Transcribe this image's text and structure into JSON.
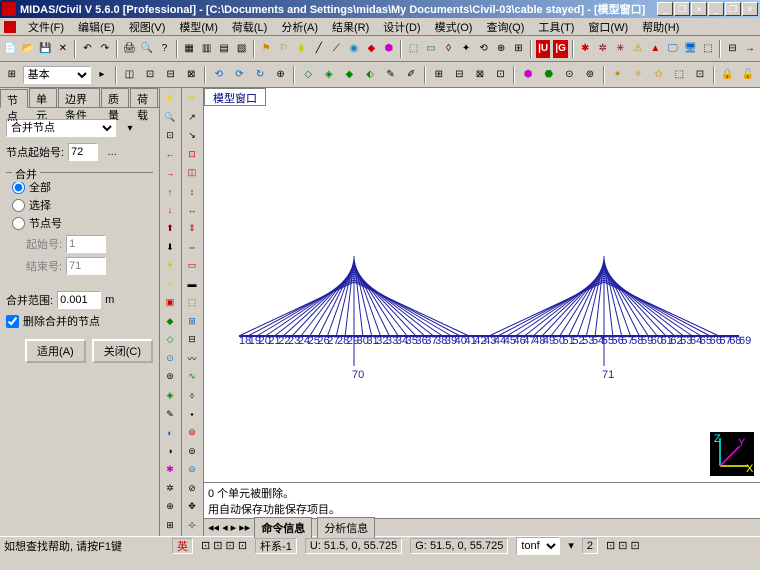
{
  "title": "MIDAS/Civil V 5.6.0 [Professional] - [C:\\Documents and Settings\\midas\\My Documents\\Civil-03\\cable stayed] - [模型窗口]",
  "menus": [
    "文件(F)",
    "编辑(E)",
    "视图(V)",
    "模型(M)",
    "荷载(L)",
    "分析(A)",
    "结果(R)",
    "设计(D)",
    "模式(O)",
    "查询(Q)",
    "工具(T)",
    "窗口(W)",
    "帮助(H)"
  ],
  "toolbar2_select": "基本",
  "left_tabs": [
    "节点",
    "单元",
    "边界条件",
    "质量",
    "荷载"
  ],
  "panel": {
    "combo_label": "合并节点",
    "start_label": "节点起始号:",
    "start_value": "72",
    "group_title": "合并",
    "radio_all": "全部",
    "radio_select": "选择",
    "radio_node": "节点号",
    "from_label": "起始号:",
    "from_value": "1",
    "to_label": "结束号:",
    "to_value": "71",
    "range_label": "合并范围:",
    "range_value": "0.001",
    "range_unit": "m",
    "del_check": "删除合并的节点",
    "apply": "适用(A)",
    "close": "关闭(C)"
  },
  "canvas_tab": "模型窗口",
  "node_labels_left": [
    "70"
  ],
  "node_labels_right": [
    "71"
  ],
  "log_lines": [
    "0 个单元被删除。",
    "用自动保存功能保存项目。"
  ],
  "bottom_tabs": [
    "命令信息",
    "分析信息"
  ],
  "status": {
    "help": "如想查找帮助, 请按F1键",
    "ime": "英",
    "frame": "杆系-1",
    "u": "U: 51.5, 0, 55.725",
    "g": "G: 51.5, 0, 55.725",
    "unit1": "tonf",
    "num": "2"
  },
  "axis": {
    "x": "X",
    "y": "Y",
    "z": "Z"
  }
}
